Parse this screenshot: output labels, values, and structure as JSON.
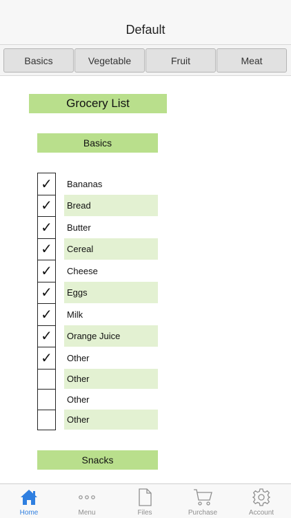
{
  "header": {
    "title": "Default"
  },
  "segments": [
    {
      "label": "Basics"
    },
    {
      "label": "Vegetable"
    },
    {
      "label": "Fruit"
    },
    {
      "label": "Meat"
    }
  ],
  "list_title": "Grocery List",
  "sections": [
    {
      "title": "Basics",
      "items": [
        {
          "label": "Bananas",
          "checked": true
        },
        {
          "label": "Bread",
          "checked": true
        },
        {
          "label": "Butter",
          "checked": true
        },
        {
          "label": "Cereal",
          "checked": true
        },
        {
          "label": "Cheese",
          "checked": true
        },
        {
          "label": "Eggs",
          "checked": true
        },
        {
          "label": "Milk",
          "checked": true
        },
        {
          "label": "Orange Juice",
          "checked": true
        },
        {
          "label": "Other",
          "checked": true
        },
        {
          "label": "Other",
          "checked": false
        },
        {
          "label": "Other",
          "checked": false
        },
        {
          "label": "Other",
          "checked": false
        }
      ]
    },
    {
      "title": "Snacks"
    }
  ],
  "check_glyph": "✓",
  "tabbar": {
    "tabs": [
      {
        "label": "Home",
        "icon": "home-icon",
        "active": true
      },
      {
        "label": "Menu",
        "icon": "more-icon",
        "active": false
      },
      {
        "label": "Files",
        "icon": "file-icon",
        "active": false
      },
      {
        "label": "Purchase",
        "icon": "cart-icon",
        "active": false
      },
      {
        "label": "Account",
        "icon": "gear-icon",
        "active": false
      }
    ]
  },
  "colors": {
    "accent": "#2f7fe0",
    "section_green": "#b9df8c",
    "row_alt_green": "#e3f1d2",
    "inactive_tab": "#8e8e8e"
  }
}
